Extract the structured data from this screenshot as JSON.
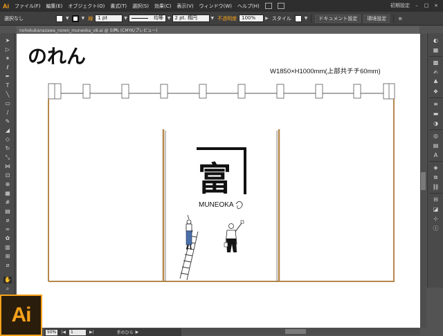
{
  "app": {
    "logo": "Ai"
  },
  "menubar": {
    "items": [
      "ファイル(F)",
      "編集(E)",
      "オブジェクト(O)",
      "書式(T)",
      "選択(S)",
      "効果(C)",
      "表示(V)",
      "ウィンドウ(W)",
      "ヘルプ(H)"
    ],
    "workspace": "初期設定",
    "window_controls": [
      "–",
      "□",
      "×"
    ]
  },
  "controlbar": {
    "selection_label": "選択なし",
    "stroke_label": "線",
    "stroke_weight": "1 pt",
    "profile_label": "均等",
    "brush_label": "2 pt. 楕円",
    "opacity_label": "不透明度",
    "opacity_value": "100%",
    "style_label": "スタイル",
    "doc_setup_button": "ドキュメント設定",
    "preferences_button": "環境設定"
  },
  "document": {
    "tab_title": "nohokukanazawa_noren_muneoka_v8.ai @ 50% (CMYK/プレビュー)",
    "close_glyph": "×"
  },
  "artwork": {
    "title": "のれん",
    "dimension_note": "W1850×H1000mm(上部共チチ60mm)",
    "logo_kanji": "富",
    "brand_name": "MUNEOKA"
  },
  "statusbar": {
    "zoom": "50%",
    "page": "1",
    "tool_name": "手のひら"
  },
  "colors": {
    "accent": "#f7a21b",
    "pole": "#b5874a"
  }
}
